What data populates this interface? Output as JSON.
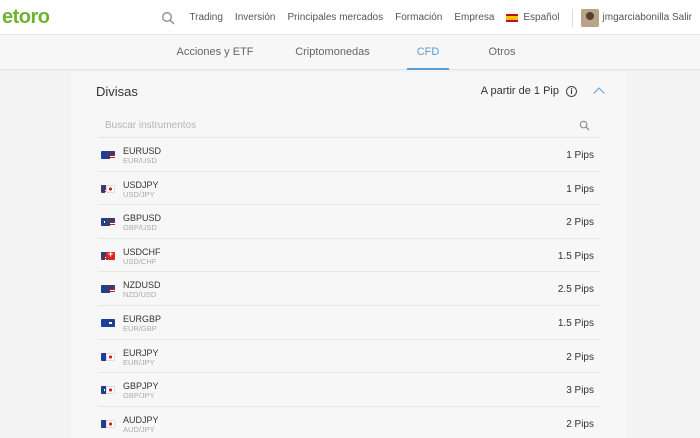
{
  "header": {
    "logo": "etoro",
    "nav": [
      "Trading",
      "Inversión",
      "Principales mercados",
      "Formación",
      "Empresa"
    ],
    "language": "Español",
    "user": "jmgarciabonilla Salir"
  },
  "tabs": [
    {
      "label": "Acciones y ETF",
      "active": false
    },
    {
      "label": "Criptomonedas",
      "active": false
    },
    {
      "label": "CFD",
      "active": true
    },
    {
      "label": "Otros",
      "active": false
    }
  ],
  "panel": {
    "title": "Divisas",
    "spread_label": "A partir de 1 Pip",
    "search_placeholder": "Buscar instrumentos"
  },
  "instruments": [
    {
      "symbol": "EURUSD",
      "pair": "EUR/USD",
      "pips": "1 Pips",
      "flags": [
        "eu",
        "us"
      ]
    },
    {
      "symbol": "USDJPY",
      "pair": "USD/JPY",
      "pips": "1 Pips",
      "flags": [
        "us",
        "jp"
      ]
    },
    {
      "symbol": "GBPUSD",
      "pair": "GBP/USD",
      "pips": "2 Pips",
      "flags": [
        "gb",
        "us"
      ]
    },
    {
      "symbol": "USDCHF",
      "pair": "USD/CHF",
      "pips": "1.5 Pips",
      "flags": [
        "us",
        "ch"
      ]
    },
    {
      "symbol": "NZDUSD",
      "pair": "NZD/USD",
      "pips": "2.5 Pips",
      "flags": [
        "nz",
        "us"
      ]
    },
    {
      "symbol": "EURGBP",
      "pair": "EUR/GBP",
      "pips": "1.5 Pips",
      "flags": [
        "eu",
        "gb"
      ]
    },
    {
      "symbol": "EURJPY",
      "pair": "EUR/JPY",
      "pips": "2 Pips",
      "flags": [
        "eu",
        "jp"
      ]
    },
    {
      "symbol": "GBPJPY",
      "pair": "GBP/JPY",
      "pips": "3 Pips",
      "flags": [
        "gb",
        "jp"
      ]
    },
    {
      "symbol": "AUDJPY",
      "pair": "AUD/JPY",
      "pips": "2 Pips",
      "flags": [
        "au",
        "jp"
      ]
    }
  ],
  "colors": {
    "brand": "#6cb42f",
    "accent": "#5a9bd5"
  }
}
